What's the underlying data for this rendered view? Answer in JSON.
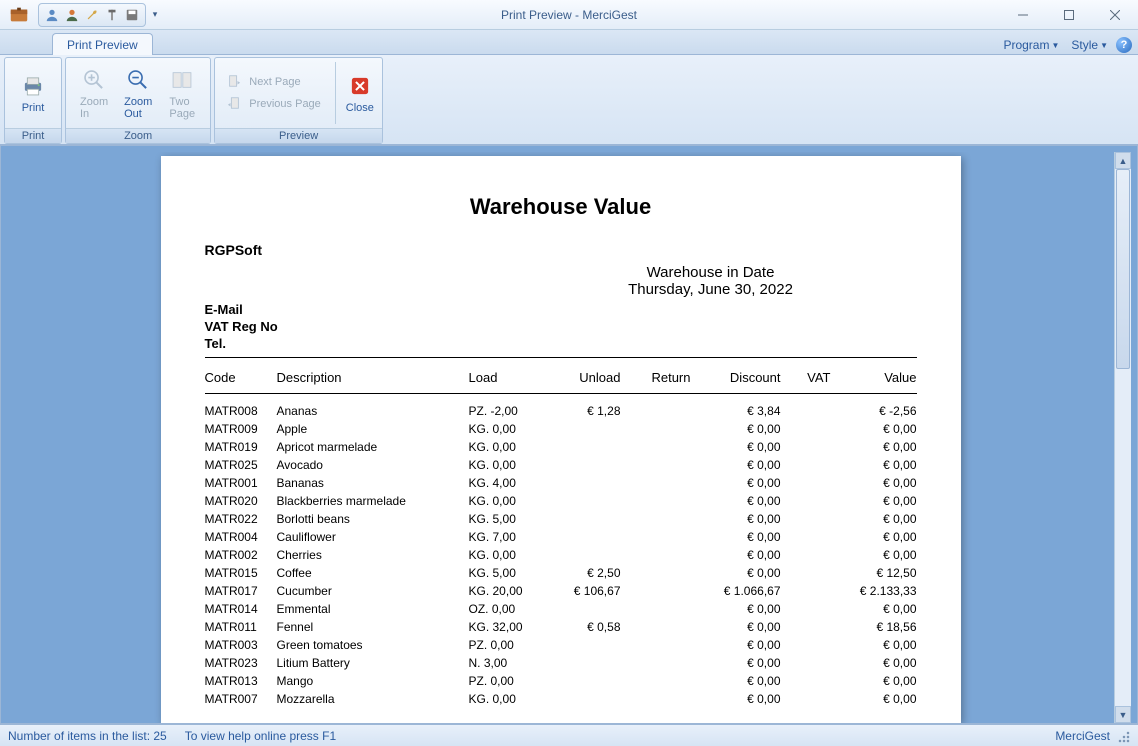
{
  "window": {
    "title": "Print Preview - MerciGest",
    "tab": "Print Preview",
    "menu_program": "Program",
    "menu_style": "Style"
  },
  "ribbon": {
    "print": {
      "label": "Print",
      "group": "Print"
    },
    "zoom_in": {
      "label": "Zoom In"
    },
    "zoom_out": {
      "label": "Zoom Out"
    },
    "two_page": {
      "label": "Two Page"
    },
    "zoom_group": "Zoom",
    "next_page": "Next Page",
    "previous_page": "Previous Page",
    "close": "Close",
    "preview_group": "Preview"
  },
  "report": {
    "title": "Warehouse Value",
    "company": "RGPSoft",
    "date_header": "Warehouse in Date",
    "date_value": "Thursday, June 30, 2022",
    "email_label": "E-Mail",
    "vat_label": "VAT Reg No",
    "tel_label": "Tel.",
    "columns": {
      "code": "Code",
      "description": "Description",
      "load": "Load",
      "unload": "Unload",
      "return": "Return",
      "discount": "Discount",
      "vat": "VAT",
      "value": "Value"
    },
    "rows": [
      {
        "code": "MATR008",
        "description": "Ananas",
        "load": "PZ. -2,00",
        "unload": "€ 1,28",
        "return": "",
        "discount": "€ 3,84",
        "vat": "",
        "value": "€ -2,56"
      },
      {
        "code": "MATR009",
        "description": "Apple",
        "load": "KG. 0,00",
        "unload": "",
        "return": "",
        "discount": "€ 0,00",
        "vat": "",
        "value": "€ 0,00"
      },
      {
        "code": "MATR019",
        "description": "Apricot marmelade",
        "load": "KG. 0,00",
        "unload": "",
        "return": "",
        "discount": "€ 0,00",
        "vat": "",
        "value": "€ 0,00"
      },
      {
        "code": "MATR025",
        "description": "Avocado",
        "load": "KG. 0,00",
        "unload": "",
        "return": "",
        "discount": "€ 0,00",
        "vat": "",
        "value": "€ 0,00"
      },
      {
        "code": "MATR001",
        "description": "Bananas",
        "load": "KG. 4,00",
        "unload": "",
        "return": "",
        "discount": "€ 0,00",
        "vat": "",
        "value": "€ 0,00"
      },
      {
        "code": "MATR020",
        "description": "Blackberries marmelade",
        "load": "KG. 0,00",
        "unload": "",
        "return": "",
        "discount": "€ 0,00",
        "vat": "",
        "value": "€ 0,00"
      },
      {
        "code": "MATR022",
        "description": "Borlotti beans",
        "load": "KG. 5,00",
        "unload": "",
        "return": "",
        "discount": "€ 0,00",
        "vat": "",
        "value": "€ 0,00"
      },
      {
        "code": "MATR004",
        "description": "Cauliflower",
        "load": "KG. 7,00",
        "unload": "",
        "return": "",
        "discount": "€ 0,00",
        "vat": "",
        "value": "€ 0,00"
      },
      {
        "code": "MATR002",
        "description": "Cherries",
        "load": "KG. 0,00",
        "unload": "",
        "return": "",
        "discount": "€ 0,00",
        "vat": "",
        "value": "€ 0,00"
      },
      {
        "code": "MATR015",
        "description": "Coffee",
        "load": "KG. 5,00",
        "unload": "€ 2,50",
        "return": "",
        "discount": "€ 0,00",
        "vat": "",
        "value": "€ 12,50"
      },
      {
        "code": "MATR017",
        "description": "Cucumber",
        "load": "KG. 20,00",
        "unload": "€ 106,67",
        "return": "",
        "discount": "€ 1.066,67",
        "vat": "",
        "value": "€ 2.133,33"
      },
      {
        "code": "MATR014",
        "description": "Emmental",
        "load": "OZ. 0,00",
        "unload": "",
        "return": "",
        "discount": "€ 0,00",
        "vat": "",
        "value": "€ 0,00"
      },
      {
        "code": "MATR011",
        "description": "Fennel",
        "load": "KG. 32,00",
        "unload": "€ 0,58",
        "return": "",
        "discount": "€ 0,00",
        "vat": "",
        "value": "€ 18,56"
      },
      {
        "code": "MATR003",
        "description": "Green tomatoes",
        "load": "PZ. 0,00",
        "unload": "",
        "return": "",
        "discount": "€ 0,00",
        "vat": "",
        "value": "€ 0,00"
      },
      {
        "code": "MATR023",
        "description": "Litium Battery",
        "load": "N. 3,00",
        "unload": "",
        "return": "",
        "discount": "€ 0,00",
        "vat": "",
        "value": "€ 0,00"
      },
      {
        "code": "MATR013",
        "description": "Mango",
        "load": "PZ. 0,00",
        "unload": "",
        "return": "",
        "discount": "€ 0,00",
        "vat": "",
        "value": "€ 0,00"
      },
      {
        "code": "MATR007",
        "description": "Mozzarella",
        "load": "KG. 0,00",
        "unload": "",
        "return": "",
        "discount": "€ 0,00",
        "vat": "",
        "value": "€ 0,00"
      }
    ]
  },
  "statusbar": {
    "items_label": "Number of items in the list: 25",
    "help_label": "To view help online press F1",
    "app_name": "MerciGest"
  }
}
